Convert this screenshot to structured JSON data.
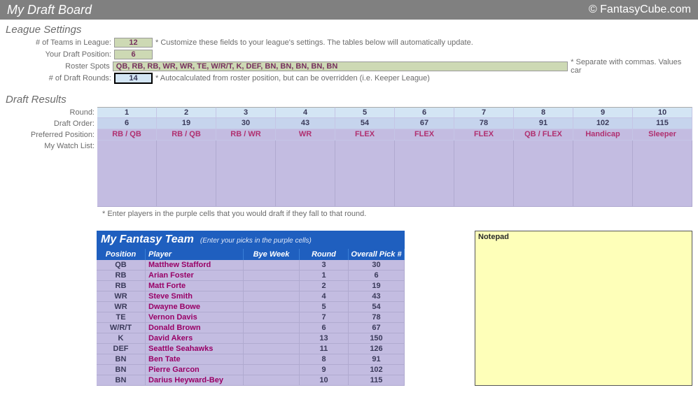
{
  "header": {
    "title": "My Draft Board",
    "brand": "© FantasyCube.com"
  },
  "settings": {
    "head": "League Settings",
    "teams_label": "# of Teams in League:",
    "teams_val": "12",
    "pos_label": "Your Draft Position:",
    "pos_val": "6",
    "roster_label": "Roster Spots",
    "roster_val": "QB, RB, RB, WR, WR, TE, W/R/T, K, DEF, BN, BN, BN, BN, BN",
    "rounds_label": "# of Draft Rounds:",
    "rounds_val": "14",
    "note1": "* Customize these fields to your league's settings. The tables below will automatically update.",
    "note2": "* Separate with commas. Values car",
    "note3": "* Autocalculated from roster position, but can be overridden (i.e. Keeper League)"
  },
  "results": {
    "head": "Draft Results",
    "labels": {
      "round": "Round:",
      "order": "Draft Order:",
      "pref": "Preferred Position:",
      "watch": "My Watch List:"
    },
    "rounds": [
      "1",
      "2",
      "3",
      "4",
      "5",
      "6",
      "7",
      "8",
      "9",
      "10"
    ],
    "order": [
      "6",
      "19",
      "30",
      "43",
      "54",
      "67",
      "78",
      "91",
      "102",
      "115"
    ],
    "pref": [
      "RB / QB",
      "RB / QB",
      "RB / WR",
      "WR",
      "FLEX",
      "FLEX",
      "FLEX",
      "QB / FLEX",
      "Handicap",
      "Sleeper"
    ],
    "footnote": "* Enter players in the purple cells that you would draft if they fall to that round."
  },
  "team": {
    "title": "My Fantasy Team",
    "subtitle": "(Enter your picks in the purple cells)",
    "cols": {
      "pos": "Position",
      "ply": "Player",
      "bye": "Bye Week",
      "rnd": "Round",
      "pick": "Overall Pick #"
    },
    "rows": [
      {
        "pos": "QB",
        "ply": "Matthew Stafford",
        "rnd": "3",
        "pick": "30"
      },
      {
        "pos": "RB",
        "ply": "Arian Foster",
        "rnd": "1",
        "pick": "6"
      },
      {
        "pos": "RB",
        "ply": "Matt Forte",
        "rnd": "2",
        "pick": "19"
      },
      {
        "pos": "WR",
        "ply": "Steve Smith",
        "rnd": "4",
        "pick": "43"
      },
      {
        "pos": "WR",
        "ply": "Dwayne Bowe",
        "rnd": "5",
        "pick": "54"
      },
      {
        "pos": "TE",
        "ply": "Vernon Davis",
        "rnd": "7",
        "pick": "78"
      },
      {
        "pos": "W/R/T",
        "ply": "Donald Brown",
        "rnd": "6",
        "pick": "67"
      },
      {
        "pos": "K",
        "ply": "David Akers",
        "rnd": "13",
        "pick": "150"
      },
      {
        "pos": "DEF",
        "ply": "Seattle Seahawks",
        "rnd": "11",
        "pick": "126"
      },
      {
        "pos": "BN",
        "ply": "Ben Tate",
        "rnd": "8",
        "pick": "91"
      },
      {
        "pos": "BN",
        "ply": "Pierre Garcon",
        "rnd": "9",
        "pick": "102"
      },
      {
        "pos": "BN",
        "ply": "Darius Heyward-Bey",
        "rnd": "10",
        "pick": "115"
      }
    ]
  },
  "notepad": {
    "title": "Notepad"
  }
}
